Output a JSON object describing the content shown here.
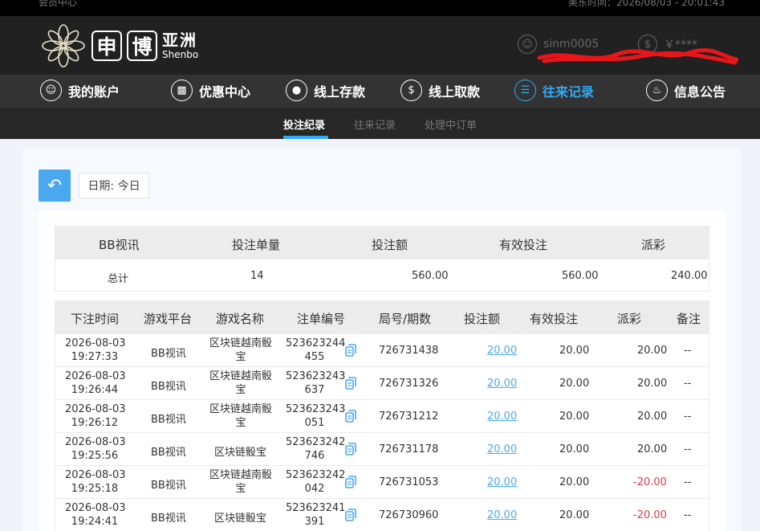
{
  "topbar": {
    "left_text": "会员中心",
    "right_text": "美东时间：2026/08/03 - 20:01:43"
  },
  "brand": {
    "logo_char1": "申",
    "logo_char2": "博",
    "cn": "亚洲",
    "en": "Shenbo"
  },
  "user": {
    "username": "sinm0005",
    "balance": "￥****"
  },
  "main_nav": [
    {
      "label": "我的账户",
      "icon": "user-icon"
    },
    {
      "label": "优惠中心",
      "icon": "gift-icon"
    },
    {
      "label": "线上存款",
      "icon": "deposit-icon"
    },
    {
      "label": "线上取款",
      "icon": "withdraw-icon"
    },
    {
      "label": "往来记录",
      "icon": "records-icon"
    },
    {
      "label": "信息公告",
      "icon": "bell-icon"
    }
  ],
  "sub_nav": [
    {
      "label": "投注纪录"
    },
    {
      "label": "往来记录"
    },
    {
      "label": "处理中订单"
    }
  ],
  "filter": {
    "date_label": "日期: 今日"
  },
  "summary": {
    "headers": [
      "BB视讯",
      "投注单量",
      "投注额",
      "有效投注",
      "派彩"
    ],
    "row": [
      "总计",
      "14",
      "560.00",
      "560.00",
      "240.00"
    ]
  },
  "detail": {
    "headers": [
      "下注时间",
      "游戏平台",
      "游戏名称",
      "注单编号",
      "局号/期数",
      "投注额",
      "有效投注",
      "派彩",
      "备注"
    ],
    "rows": [
      {
        "date": "2026-08-03",
        "time": "19:27:33",
        "platform": "BB视讯",
        "game_l1": "区块链越南骰",
        "game_l2": "宝",
        "order_l1": "523623244",
        "order_l2": "455",
        "round": "726731438",
        "bet": "20.00",
        "valid": "20.00",
        "payout": "20.00",
        "note": "--"
      },
      {
        "date": "2026-08-03",
        "time": "19:26:44",
        "platform": "BB视讯",
        "game_l1": "区块链越南骰",
        "game_l2": "宝",
        "order_l1": "523623243",
        "order_l2": "637",
        "round": "726731326",
        "bet": "20.00",
        "valid": "20.00",
        "payout": "20.00",
        "note": "--"
      },
      {
        "date": "2026-08-03",
        "time": "19:26:12",
        "platform": "BB视讯",
        "game_l1": "区块链越南骰",
        "game_l2": "宝",
        "order_l1": "523623243",
        "order_l2": "051",
        "round": "726731212",
        "bet": "20.00",
        "valid": "20.00",
        "payout": "20.00",
        "note": "--"
      },
      {
        "date": "2026-08-03",
        "time": "19:25:56",
        "platform": "BB视讯",
        "game_l1": "区块链骰宝",
        "game_l2": "",
        "order_l1": "523623242",
        "order_l2": "746",
        "round": "726731178",
        "bet": "20.00",
        "valid": "20.00",
        "payout": "20.00",
        "note": "--"
      },
      {
        "date": "2026-08-03",
        "time": "19:25:18",
        "platform": "BB视讯",
        "game_l1": "区块链越南骰",
        "game_l2": "宝",
        "order_l1": "523623242",
        "order_l2": "042",
        "round": "726731053",
        "bet": "20.00",
        "valid": "20.00",
        "payout": "-20.00",
        "note": "--"
      },
      {
        "date": "2026-08-03",
        "time": "19:24:41",
        "platform": "BB视讯",
        "game_l1": "区块链骰宝",
        "game_l2": "",
        "order_l1": "523623241",
        "order_l2": "391",
        "round": "726730960",
        "bet": "20.00",
        "valid": "20.00",
        "payout": "-20.00",
        "note": "--"
      }
    ]
  },
  "colors": {
    "accent": "#33aaf5",
    "negative": "#e03a4a",
    "header_bg": "#212121",
    "nav_bg": "#333333"
  }
}
